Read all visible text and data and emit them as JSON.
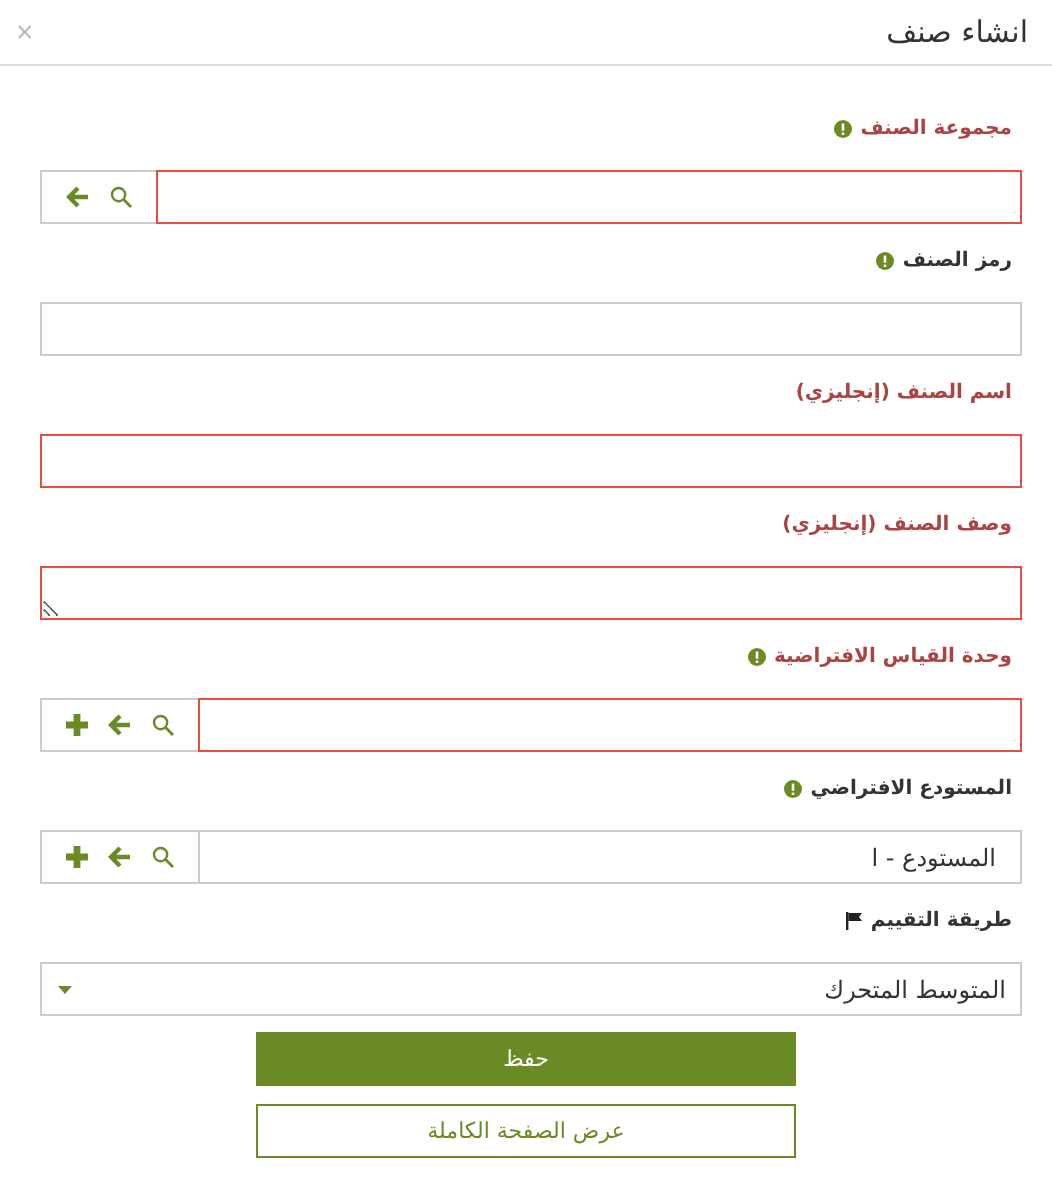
{
  "window": {
    "title": "انشاء صنف",
    "close": "×"
  },
  "fields": [
    {
      "kind": "lookup",
      "label": "مجموعة الصنف",
      "info": true,
      "flagged": false,
      "invalid": true,
      "addable": false
    },
    {
      "kind": "text",
      "label": "رمز الصنف",
      "info": true,
      "flagged": false,
      "invalid": false
    },
    {
      "kind": "text",
      "label": "اسم الصنف (إنجليزي)",
      "info": false,
      "flagged": false,
      "invalid": true
    },
    {
      "kind": "textarea",
      "label": "وصف الصنف (إنجليزي)",
      "info": false,
      "flagged": false,
      "invalid": true
    },
    {
      "kind": "lookup",
      "label": "وحدة القياس الافتراضية",
      "info": true,
      "flagged": false,
      "invalid": true,
      "addable": true
    },
    {
      "kind": "lookup",
      "label": "المستودع الافتراضي",
      "info": true,
      "flagged": false,
      "invalid": false,
      "addable": true,
      "value": "المستودع - ا"
    },
    {
      "kind": "select",
      "label": "طريقة التقييم",
      "info": false,
      "flagged": true,
      "invalid": false,
      "value": "المتوسط المتحرك"
    }
  ],
  "buttons": [
    {
      "label": "حفظ",
      "kind": "primary"
    },
    {
      "label": "عرض الصفحة الكاملة",
      "kind": "outline"
    }
  ]
}
